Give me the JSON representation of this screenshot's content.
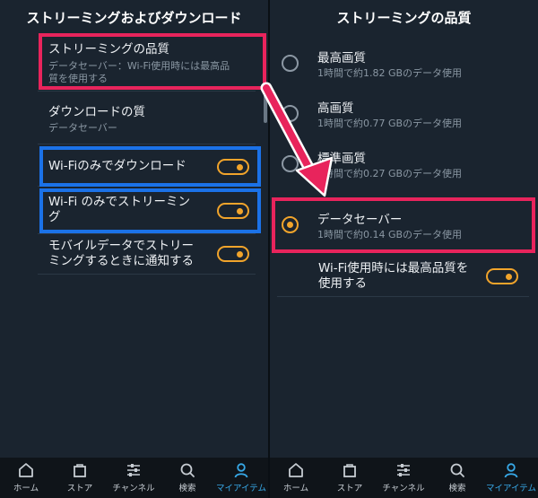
{
  "left": {
    "title": "ストリーミングおよびダウンロード",
    "items": [
      {
        "label": "ストリーミングの品質",
        "sub1": "データセーバー：Wi-Fi使用時には最高品",
        "sub2": "質を使用する"
      },
      {
        "label": "ダウンロードの質",
        "sub1": "データセーバー"
      },
      {
        "label": "Wi-Fiのみでダウンロード",
        "toggle": true
      },
      {
        "label1": "Wi-Fi のみでストリーミン",
        "label2": "グ",
        "toggle": true
      },
      {
        "label1": "モバイルデータでストリー",
        "label2": "ミングするときに通知する",
        "toggle": true
      }
    ]
  },
  "right": {
    "title": "ストリーミングの品質",
    "options": [
      {
        "label": "最高画質",
        "sub": "1時間で約1.82 GBのデータ使用",
        "selected": false
      },
      {
        "label": "高画質",
        "sub": "1時間で約0.77 GBのデータ使用",
        "selected": false
      },
      {
        "label": "標準画質",
        "sub": "1時間で約0.27 GBのデータ使用",
        "selected": false
      },
      {
        "label": "データセーバー",
        "sub": "1時間で約0.14 GBのデータ使用",
        "selected": true
      }
    ],
    "wifi_best": {
      "label1": "Wi-Fi使用時には最高品質を",
      "label2": "使用する",
      "toggle": true
    }
  },
  "nav": [
    {
      "label": "ホーム",
      "icon": "home-icon",
      "active": false
    },
    {
      "label": "ストア",
      "icon": "store-bag-icon",
      "active": false
    },
    {
      "label": "チャンネル",
      "icon": "channels-icon",
      "active": false
    },
    {
      "label": "検索",
      "icon": "search-icon",
      "active": false
    },
    {
      "label": "マイアイテム",
      "icon": "profile-icon",
      "active": true
    }
  ],
  "colors": {
    "background": "#1a242f",
    "accent_toggle": "#f1a42b",
    "highlight_pink": "#e8245c",
    "highlight_blue": "#1b72e8",
    "nav_active": "#37a8e6"
  }
}
